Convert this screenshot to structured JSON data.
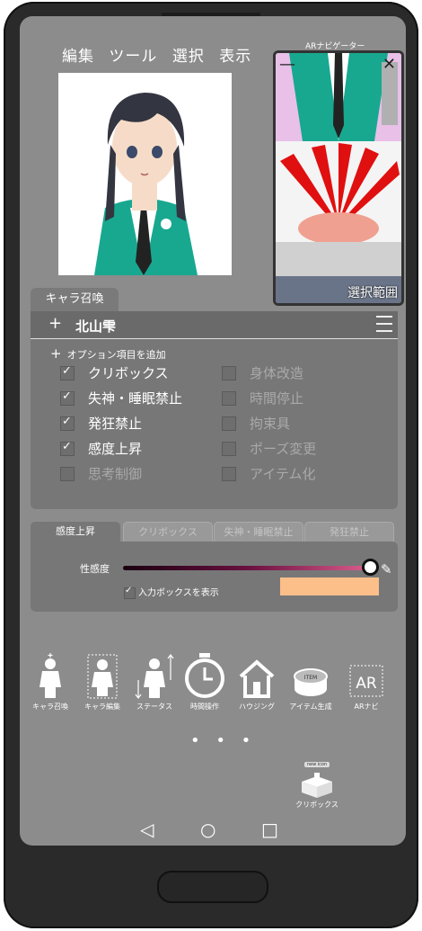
{
  "menu": [
    "編集",
    "ツール",
    "選択",
    "表示"
  ],
  "ar_panel": {
    "title": "ARナビゲーター",
    "selection_label": "選択範囲"
  },
  "character": {
    "tab_label": "キャラ召喚",
    "name": "北山雫",
    "add_symbol": "+"
  },
  "options": {
    "add_label": "オプション項目を追加",
    "left": [
      {
        "label": "クリボックス",
        "checked": true
      },
      {
        "label": "失神・睡眠禁止",
        "checked": true
      },
      {
        "label": "発狂禁止",
        "checked": true
      },
      {
        "label": "感度上昇",
        "checked": true
      },
      {
        "label": "思考制御",
        "checked": false
      }
    ],
    "right": [
      {
        "label": "身体改造",
        "checked": false
      },
      {
        "label": "時間停止",
        "checked": false
      },
      {
        "label": "拘束具",
        "checked": false
      },
      {
        "label": "ポーズ変更",
        "checked": false
      },
      {
        "label": "アイテム化",
        "checked": false
      }
    ]
  },
  "detail_tabs": [
    "感度上昇",
    "クリボックス",
    "失神・睡眠禁止",
    "発狂禁止"
  ],
  "sensitivity": {
    "label": "性感度",
    "value": 0.98,
    "show_input_label": "入力ボックスを表示",
    "show_input_checked": true,
    "input_color": "#fcbf8a"
  },
  "tools": [
    {
      "label": "キャラ召喚",
      "icon": "person-plus-icon"
    },
    {
      "label": "キャラ編集",
      "icon": "person-frame-icon"
    },
    {
      "label": "ステータス",
      "icon": "person-arrows-icon"
    },
    {
      "label": "時間操作",
      "icon": "clock-icon"
    },
    {
      "label": "ハウジング",
      "icon": "house-icon"
    },
    {
      "label": "アイテム生成",
      "icon": "item-drum-icon"
    },
    {
      "label": "ARナビ",
      "icon": "ar-icon",
      "icon_text": "AR"
    }
  ],
  "more": "• • •",
  "clipbox": {
    "badge": "new icon",
    "label": "クリボックス"
  },
  "nav": {
    "back": "◁",
    "home": "○",
    "recent": "□"
  }
}
